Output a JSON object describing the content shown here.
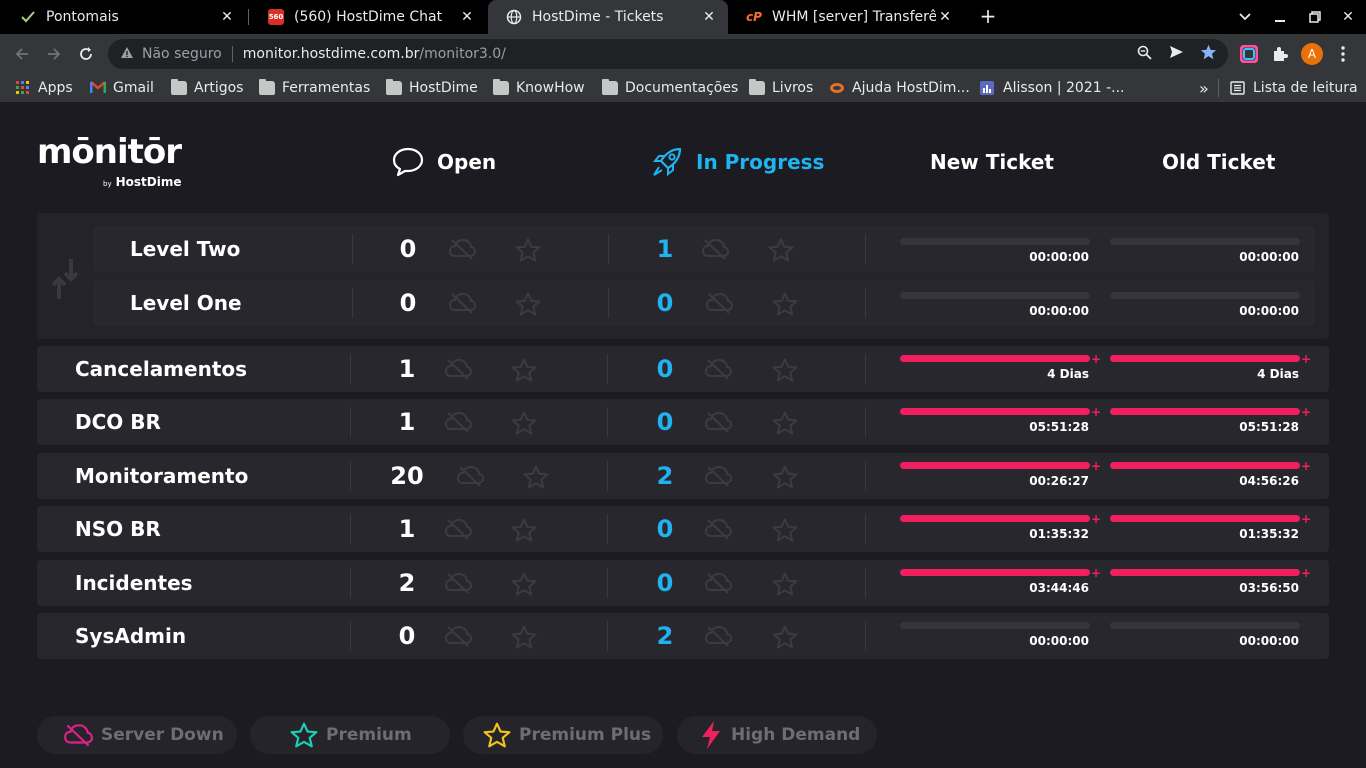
{
  "browser": {
    "tabs": [
      {
        "title": "Pontomais",
        "icon": "check-icon",
        "active": false
      },
      {
        "title": "(560) HostDime Chat",
        "icon": "chat-badge-icon",
        "badge": "560",
        "active": false
      },
      {
        "title": "HostDime - Tickets",
        "icon": "globe-icon",
        "active": true
      },
      {
        "title": "WHM [server] Transferên",
        "icon": "cpanel-icon",
        "active": false
      }
    ],
    "address": {
      "security_label": "Não seguro",
      "host": "monitor.hostdime.com.br",
      "path": "/monitor3.0/"
    },
    "profile_initial": "A",
    "bookmarks": [
      {
        "label": "Apps",
        "icon": "apps-grid-icon"
      },
      {
        "label": "Gmail",
        "icon": "gmail-icon"
      },
      {
        "label": "Artigos",
        "icon": "folder-icon"
      },
      {
        "label": "Ferramentas",
        "icon": "folder-icon"
      },
      {
        "label": "HostDime",
        "icon": "folder-icon"
      },
      {
        "label": "KnowHow",
        "icon": "folder-icon"
      },
      {
        "label": "Documentações",
        "icon": "folder-icon"
      },
      {
        "label": "Livros",
        "icon": "folder-icon"
      },
      {
        "label": "Ajuda HostDim...",
        "icon": "hostdime-icon"
      },
      {
        "label": "Alisson | 2021 -...",
        "icon": "chart-icon"
      }
    ],
    "more_bookmarks": "»",
    "reading_list": "Lista de leitura"
  },
  "app": {
    "logo": {
      "word": "mōnitōr",
      "by": "by",
      "brand": "HostDime"
    },
    "nav": {
      "open": "Open",
      "in_progress": "In Progress",
      "new_ticket": "New Ticket",
      "old_ticket": "Old Ticket"
    },
    "levels": [
      {
        "name": "Level Two",
        "open": "0",
        "in_progress": "1",
        "new_time": "00:00:00",
        "old_time": "00:00:00",
        "new_alert": false,
        "old_alert": false
      },
      {
        "name": "Level One",
        "open": "0",
        "in_progress": "0",
        "new_time": "00:00:00",
        "old_time": "00:00:00",
        "new_alert": false,
        "old_alert": false
      }
    ],
    "queues": [
      {
        "name": "Cancelamentos",
        "open": "1",
        "in_progress": "0",
        "new_time": "4 Dias",
        "old_time": "4 Dias",
        "new_alert": true,
        "old_alert": true
      },
      {
        "name": "DCO BR",
        "open": "1",
        "in_progress": "0",
        "new_time": "05:51:28",
        "old_time": "05:51:28",
        "new_alert": true,
        "old_alert": true
      },
      {
        "name": "Monitoramento",
        "open": "20",
        "in_progress": "2",
        "new_time": "00:26:27",
        "old_time": "04:56:26",
        "new_alert": true,
        "old_alert": true
      },
      {
        "name": "NSO BR",
        "open": "1",
        "in_progress": "0",
        "new_time": "01:35:32",
        "old_time": "01:35:32",
        "new_alert": true,
        "old_alert": true
      },
      {
        "name": "Incidentes",
        "open": "2",
        "in_progress": "0",
        "new_time": "03:44:46",
        "old_time": "03:56:50",
        "new_alert": true,
        "old_alert": true
      },
      {
        "name": "SysAdmin",
        "open": "0",
        "in_progress": "2",
        "new_time": "00:00:00",
        "old_time": "00:00:00",
        "new_alert": false,
        "old_alert": false
      }
    ],
    "legend": [
      {
        "label": "Server Down",
        "icon": "cloud-off-icon",
        "color": "#e0208a"
      },
      {
        "label": "Premium",
        "icon": "star-icon",
        "color": "#1ad1b5"
      },
      {
        "label": "Premium Plus",
        "icon": "star-icon",
        "color": "#f0c419"
      },
      {
        "label": "High Demand",
        "icon": "lightning-icon",
        "color": "#f0205e"
      }
    ],
    "colors": {
      "accent_blue": "#20b3f0",
      "alert_pink": "#f0205e",
      "background": "#1c1b21",
      "row": "#28272e"
    }
  }
}
